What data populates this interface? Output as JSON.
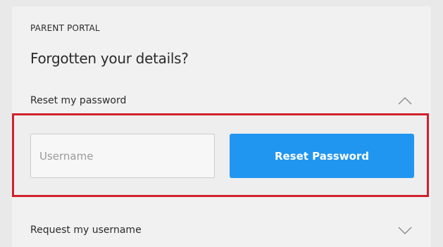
{
  "portal": {
    "eyebrow": "PARENT PORTAL",
    "title": "Forgotten your details?"
  },
  "reset_section": {
    "label": "Reset my password",
    "expanded": true,
    "chevron_icon": "chevron-up-icon",
    "username_placeholder": "Username",
    "username_value": "",
    "button_label": "Reset Password"
  },
  "request_section": {
    "label": "Request my username",
    "expanded": false,
    "chevron_icon": "chevron-down-icon"
  },
  "colors": {
    "button_background": "#2196f0",
    "highlight_border": "#d0202c",
    "card_background": "#f1f1f1"
  }
}
